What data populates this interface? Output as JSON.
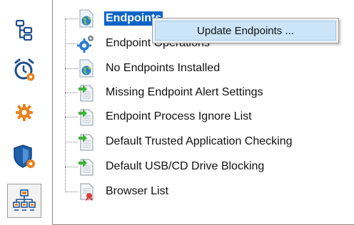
{
  "rail": {
    "buttons": [
      {
        "icon": "hierarchy-tree-icon"
      },
      {
        "icon": "alarm-clock-gear-icon"
      },
      {
        "icon": "gear-icon"
      },
      {
        "icon": "shield-gear-icon"
      },
      {
        "icon": "network-computers-icon"
      }
    ]
  },
  "tree": {
    "items": [
      {
        "label": "Endpoints",
        "icon": "endpoint-globe-icon",
        "selected": true
      },
      {
        "label": "Endpoint Operations",
        "icon": "endpoint-gear-icon"
      },
      {
        "label": "No Endpoints Installed",
        "icon": "endpoint-globe-icon"
      },
      {
        "label": "Missing Endpoint Alert Settings",
        "icon": "document-arrow-icon"
      },
      {
        "label": "Endpoint Process Ignore List",
        "icon": "document-arrow-icon"
      },
      {
        "label": "Default Trusted Application Checking",
        "icon": "document-arrow-icon"
      },
      {
        "label": "Default USB/CD Drive Blocking",
        "icon": "document-arrow-icon"
      },
      {
        "label": "Browser List",
        "icon": "document-seal-icon"
      }
    ]
  },
  "context_menu": {
    "items": [
      {
        "label": "Update Endpoints ..."
      }
    ]
  },
  "colors": {
    "selection": "#0a64c8",
    "menu_hover": "#cce4f7",
    "accent_blue": "#1d5fa8",
    "accent_orange": "#e8831e"
  }
}
